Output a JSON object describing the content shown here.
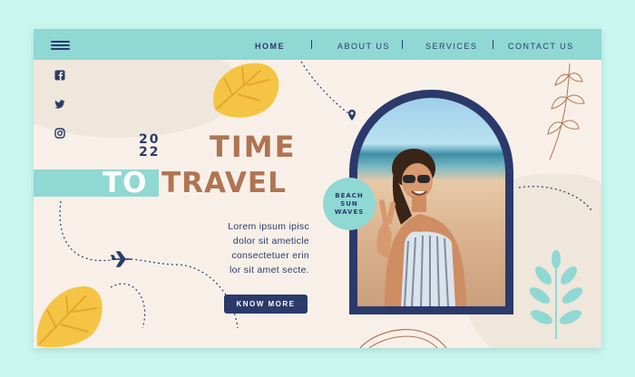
{
  "nav": {
    "menu_icon": "hamburger-menu-icon",
    "items": [
      {
        "label": "HOME",
        "active": true
      },
      {
        "label": "ABOUT US",
        "active": false
      },
      {
        "label": "SERVICES",
        "active": false
      },
      {
        "label": "CONTACT US",
        "active": false
      }
    ]
  },
  "social": [
    "facebook-icon",
    "twitter-icon",
    "instagram-icon"
  ],
  "hero": {
    "year_top": "20",
    "year_bottom": "22",
    "line1": "TIME",
    "line2_highlight": "TO",
    "line2": "TRAVEL",
    "paragraph_lines": [
      "Lorem ipsum ipisc",
      "dolor sit ameticle",
      "consectetuer erin",
      "lor sit amet secte."
    ],
    "button_label": "KNOW MORE"
  },
  "badge": {
    "lines": [
      "BEACH",
      "SUN",
      "WAVES"
    ]
  },
  "colors": {
    "navy": "#2b3a6b",
    "teal": "#8fd8d4",
    "brown": "#b07452",
    "cream": "#f8f0e8",
    "yellow": "#f6c444",
    "background": "#c8f7ef"
  }
}
